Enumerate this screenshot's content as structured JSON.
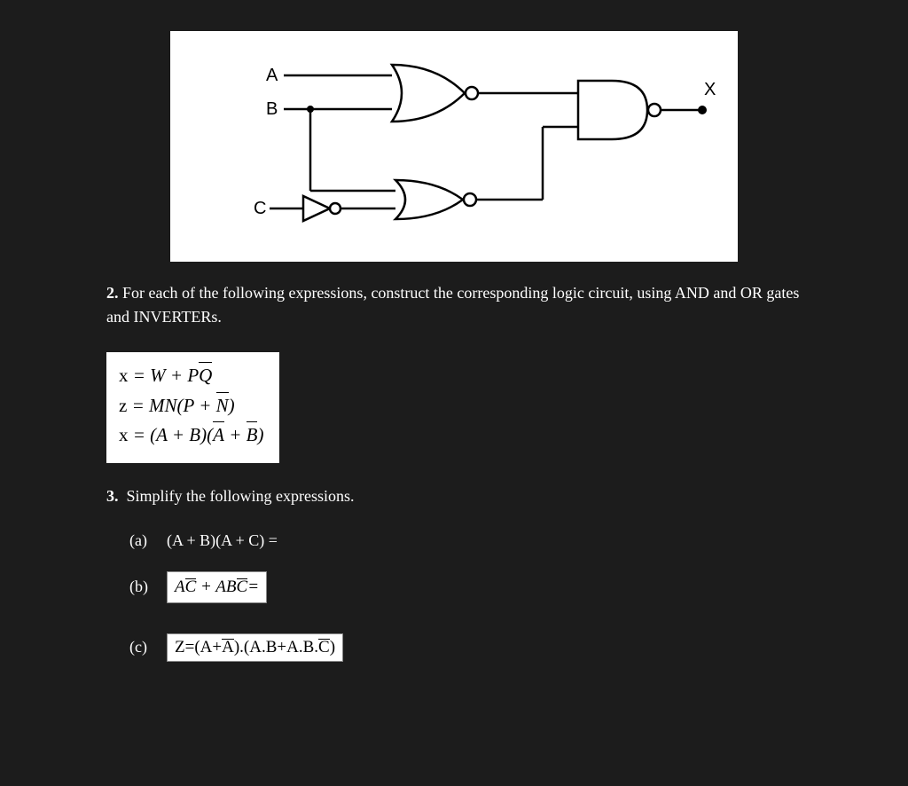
{
  "circuit": {
    "labels": {
      "A": "A",
      "B": "B",
      "C": "C",
      "X": "X"
    }
  },
  "q2": {
    "prompt_prefix": "2.",
    "prompt_text": "For each of the following expressions, construct the corresponding logic circuit, using AND and OR gates and INVERTERs.",
    "eq1_html": "<span class='upright'>x</span> = W + P<span class='ov'>Q</span>",
    "eq2_html": "<span class='upright'>z</span> = MN(P + <span class='ov'>N</span>)",
    "eq3_html": "<span class='upright'>x</span> = (A + B)(<span class='ov'>A</span> + <span class='ov'>B</span>)"
  },
  "q3": {
    "prompt_prefix": "3.",
    "prompt_text": "Simplify the following expressions.",
    "a_label": "(a)",
    "a_html": "(A + B)(A + C) =",
    "b_label": "(b)",
    "b_html": "A<span class='ov'>C</span> + AB<span class='ov'>C</span>=",
    "c_label": "(c)",
    "c_html": "<span class='upright'>Z=(A+</span><span class='ov upright'>A</span><span class='upright'>).(A.B+A.B.</span><span class='ov upright'>C</span><span class='upright'>)</span>"
  }
}
